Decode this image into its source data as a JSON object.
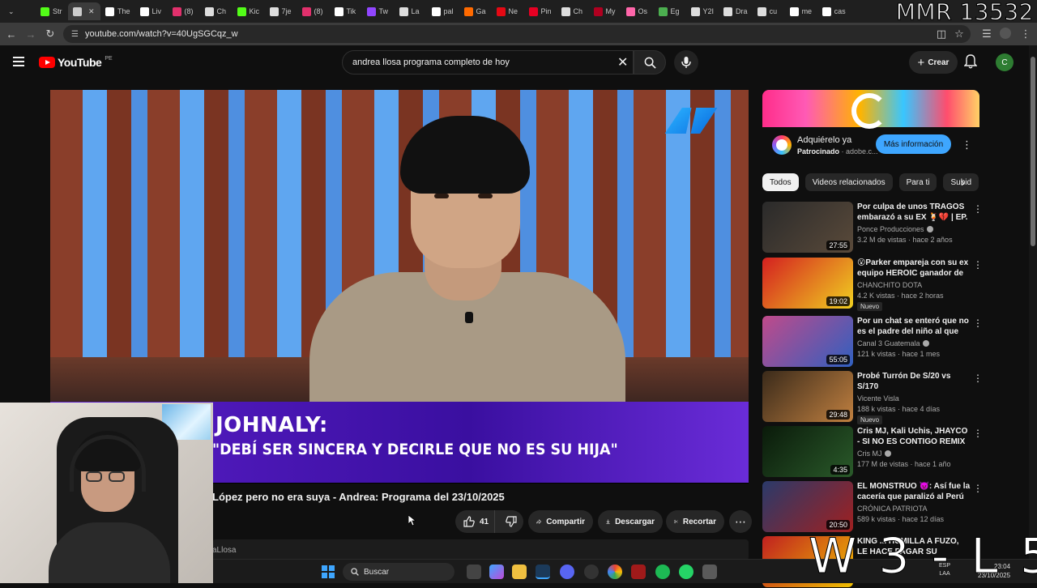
{
  "browser": {
    "tabs": [
      {
        "label": "Str",
        "icon": "kick-icon",
        "color": "#53fc18"
      },
      {
        "label": "",
        "icon": "speaker-icon",
        "color": "#cccccc",
        "active": true
      },
      {
        "label": "The",
        "icon": "diamond-icon",
        "color": "#ffffff"
      },
      {
        "label": "Liv",
        "icon": "s-icon",
        "color": "#ffffff"
      },
      {
        "label": "(8)",
        "icon": "instagram-icon",
        "color": "#e1306c"
      },
      {
        "label": "Ch",
        "icon": "openai-icon",
        "color": "#dddddd"
      },
      {
        "label": "Kic",
        "icon": "kick-icon",
        "color": "#53fc18"
      },
      {
        "label": "7je",
        "icon": "arrow-icon",
        "color": "#dddddd"
      },
      {
        "label": "(8)",
        "icon": "instagram-icon",
        "color": "#e1306c"
      },
      {
        "label": "Tik",
        "icon": "tiktok-icon",
        "color": "#ffffff"
      },
      {
        "label": "Tw",
        "icon": "twitch-icon",
        "color": "#9146ff"
      },
      {
        "label": "La",
        "icon": "globe-icon",
        "color": "#dddddd"
      },
      {
        "label": "pal",
        "icon": "diamond-icon",
        "color": "#ffffff"
      },
      {
        "label": "Ga",
        "icon": "g-icon",
        "color": "#ff6a00"
      },
      {
        "label": "Ne",
        "icon": "netflix-icon",
        "color": "#e50914"
      },
      {
        "label": "Pin",
        "icon": "pinterest-icon",
        "color": "#e60023"
      },
      {
        "label": "Ch",
        "icon": "openai-icon",
        "color": "#dddddd"
      },
      {
        "label": "My",
        "icon": "marvel-icon",
        "color": "#b00020"
      },
      {
        "label": "Os",
        "icon": "osu-icon",
        "color": "#ff66aa"
      },
      {
        "label": "Eg",
        "icon": "doc-icon",
        "color": "#4caf50"
      },
      {
        "label": "Y2I",
        "icon": "y2-icon",
        "color": "#dddddd"
      },
      {
        "label": "Dra",
        "icon": "arrow-icon",
        "color": "#dddddd"
      },
      {
        "label": "cu",
        "icon": "globe-icon",
        "color": "#dddddd"
      },
      {
        "label": "me",
        "icon": "google-icon",
        "color": "#ffffff"
      },
      {
        "label": "cas",
        "icon": "google-icon",
        "color": "#ffffff"
      }
    ],
    "url": "youtube.com/watch?v=40UgSGCqz_w"
  },
  "overlay": {
    "mmr": "MMR 13532",
    "record": "W 3 - L 5"
  },
  "youtube": {
    "logo_text": "YouTube",
    "country": "PE",
    "search_value": "andrea llosa programa completo de hoy",
    "create_label": "Crear",
    "avatar_letter": "C"
  },
  "video": {
    "lower_third_top": "JOHNALY:",
    "lower_third_bottom": "\"DEBÍ SER SINCERA Y DECIRLE QUE NO ES SU HIJA\"",
    "title": "López pero no era suya - Andrea: Programa del 23/10/2025",
    "likes": "41",
    "share_label": "Compartir",
    "download_label": "Descargar",
    "clip_label": "Recortar",
    "channel_partial": "aLlosa"
  },
  "ad": {
    "title": "Adquiérelo ya",
    "sponsored": "Patrocinado",
    "domain": "adobe.c...",
    "cta": "Más información"
  },
  "chips": [
    "Todos",
    "Videos relacionados",
    "Para ti",
    "Subid"
  ],
  "recommendations": [
    {
      "title": "Por culpa de unos TRAGOS embarazó a su EX 🍹💔 | EP. ...",
      "channel": "Ponce Producciones",
      "verified": true,
      "meta": "3.2 M de vistas · hace 2 años",
      "duration": "27:55",
      "badge": "",
      "color_a": "#2a2a2a",
      "color_b": "#5a4a3a"
    },
    {
      "title": "😮Parker empareja con su ex equipo HEROIC ganador de PG...",
      "channel": "CHANCHITO DOTA",
      "verified": false,
      "meta": "4.2 K vistas · hace 2 horas",
      "duration": "19:02",
      "badge": "Nuevo",
      "color_a": "#d42020",
      "color_b": "#f0d020"
    },
    {
      "title": "Por un chat se enteró que no es el padre del niño al que firmó | ...",
      "channel": "Canal 3 Guatemala",
      "verified": true,
      "meta": "121 k vistas · hace 1 mes",
      "duration": "55:05",
      "badge": "",
      "color_a": "#c04a8a",
      "color_b": "#3060c0"
    },
    {
      "title": "Probé Turrón De S/20 vs S/170",
      "channel": "Vicente Visla",
      "verified": false,
      "meta": "188 k vistas · hace 4 días",
      "duration": "29:48",
      "badge": "Nuevo",
      "color_a": "#3a2a1a",
      "color_b": "#c08040"
    },
    {
      "title": "Cris MJ, Kali Uchis, JHAYCO - SI NO ES CONTIGO REMIX",
      "channel": "Cris MJ",
      "verified": true,
      "meta": "177 M de vistas · hace 1 año",
      "duration": "4:35",
      "badge": "",
      "color_a": "#0a1a0a",
      "color_b": "#2a5a2a"
    },
    {
      "title": "EL MONSTRUO 👿: Así fue la cacería que paralizó al Perú",
      "channel": "CRÓNICA PATRIOTA",
      "verified": false,
      "meta": "589 k vistas · hace 12 días",
      "duration": "20:50",
      "badge": "",
      "color_a": "#2a3a6a",
      "color_b": "#a02020"
    },
    {
      "title": "KING ... HUMILLA A FUZO, LE HACE PAGAR SU DESAYUNO",
      "channel": "",
      "verified": false,
      "meta": "",
      "duration": "",
      "badge": "",
      "color_a": "#c02020",
      "color_b": "#f0c000"
    }
  ],
  "taskbar": {
    "search_label": "Buscar",
    "lang_1": "ESP",
    "lang_2": "LAA",
    "time": "23:04",
    "date": "23/10/2025"
  }
}
